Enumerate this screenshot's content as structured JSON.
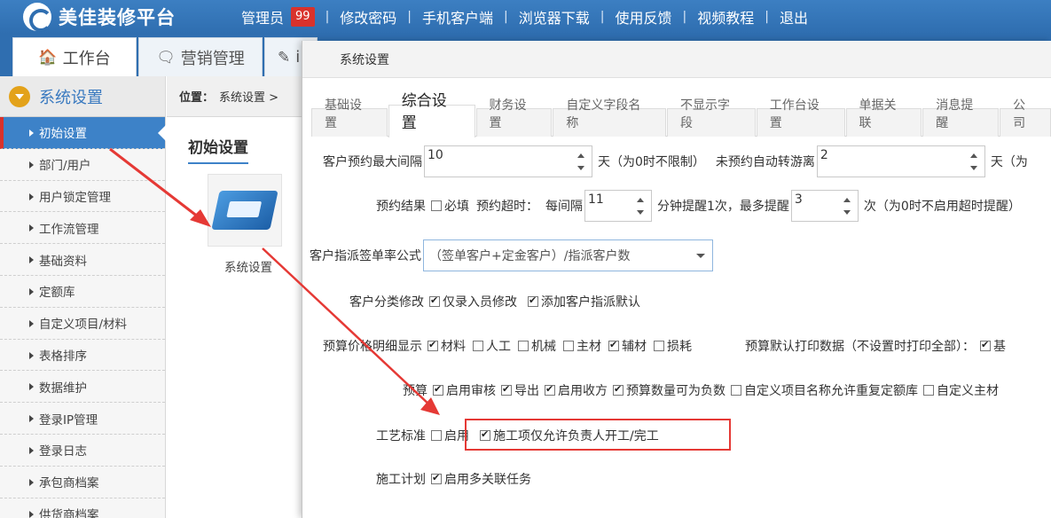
{
  "app": {
    "logo_text": "美佳装修平台",
    "nav": [
      {
        "label": "管理员"
      },
      {
        "label": "修改密码"
      },
      {
        "label": "手机客户端"
      },
      {
        "label": "浏览器下载"
      },
      {
        "label": "使用反馈"
      },
      {
        "label": "视频教程"
      },
      {
        "label": "退出"
      }
    ],
    "badge": "99",
    "nav_separator": "|"
  },
  "main_tabs": [
    {
      "label": "工作台",
      "icon": "home-icon",
      "glyph": "🏠"
    },
    {
      "label": "营销管理",
      "icon": "chat-icon",
      "glyph": "🗨"
    },
    {
      "label": "i",
      "icon": "edit-icon",
      "glyph": "✎"
    }
  ],
  "sidebar": {
    "title": "系统设置",
    "items": [
      {
        "label": "初始设置",
        "active": true
      },
      {
        "label": "部门/用户"
      },
      {
        "label": "用户锁定管理"
      },
      {
        "label": "工作流管理"
      },
      {
        "label": "基础资料"
      },
      {
        "label": "定额库"
      },
      {
        "label": "自定义项目/材料"
      },
      {
        "label": "表格排序"
      },
      {
        "label": "数据维护"
      },
      {
        "label": "登录IP管理"
      },
      {
        "label": "登录日志"
      },
      {
        "label": "承包商档案"
      },
      {
        "label": "供货商档案"
      }
    ]
  },
  "content": {
    "crumb_label": "位置：",
    "crumb_value": "系统设置 >",
    "section_title": "初始设置",
    "tile_label": "系统设置"
  },
  "modal": {
    "title": "系统设置",
    "tabs": [
      "基础设置",
      "综合设置",
      "财务设置",
      "自定义字段名称",
      "不显示字段",
      "工作台设置",
      "单据关联",
      "消息提醒",
      "公司"
    ],
    "active_tab": "综合设置",
    "row1": {
      "label": "客户预约最大间隔",
      "value": "10",
      "suffix": "天（为0时不限制）",
      "label2": "未预约自动转游离",
      "value2": "2",
      "suffix2": "天（为"
    },
    "row2": {
      "label": "预约结果",
      "cb1": "必填",
      "mid": "预约超时：",
      "every": "每间隔",
      "value1": "11",
      "mid2": "分钟提醒1次，最多提醒",
      "value2": "3",
      "suffix": "次（为0时不启用超时提醒）"
    },
    "row3": {
      "label": "客户指派签单率公式",
      "select_value": "（签单客户+定金客户）/指派客户数"
    },
    "row4": {
      "label": "客户分类修改",
      "opt1": "仅录入员修改",
      "opt2": "添加客户指派默认"
    },
    "row5": {
      "label": "预算价格明细显示",
      "opts": [
        "材料",
        "人工",
        "机械",
        "主材",
        "辅材",
        "损耗"
      ],
      "right_label": "预算默认打印数据（不设置时打印全部）：",
      "right_opt": "基"
    },
    "row6": {
      "label": "预算",
      "opts": [
        "启用审核",
        "导出",
        "启用收方",
        "预算数量可为负数",
        "自定义项目名称允许重复定额库",
        "自定义主材"
      ]
    },
    "row7": {
      "label": "工艺标准",
      "opt1": "启用",
      "opt2": "施工项仅允许负责人开工/完工"
    },
    "row8": {
      "label": "施工计划",
      "opt1": "启用多关联任务"
    }
  },
  "colors": {
    "brand_blue": "#2f6eb0",
    "highlight_red": "#e53935",
    "active_side": "#3d82c8"
  }
}
